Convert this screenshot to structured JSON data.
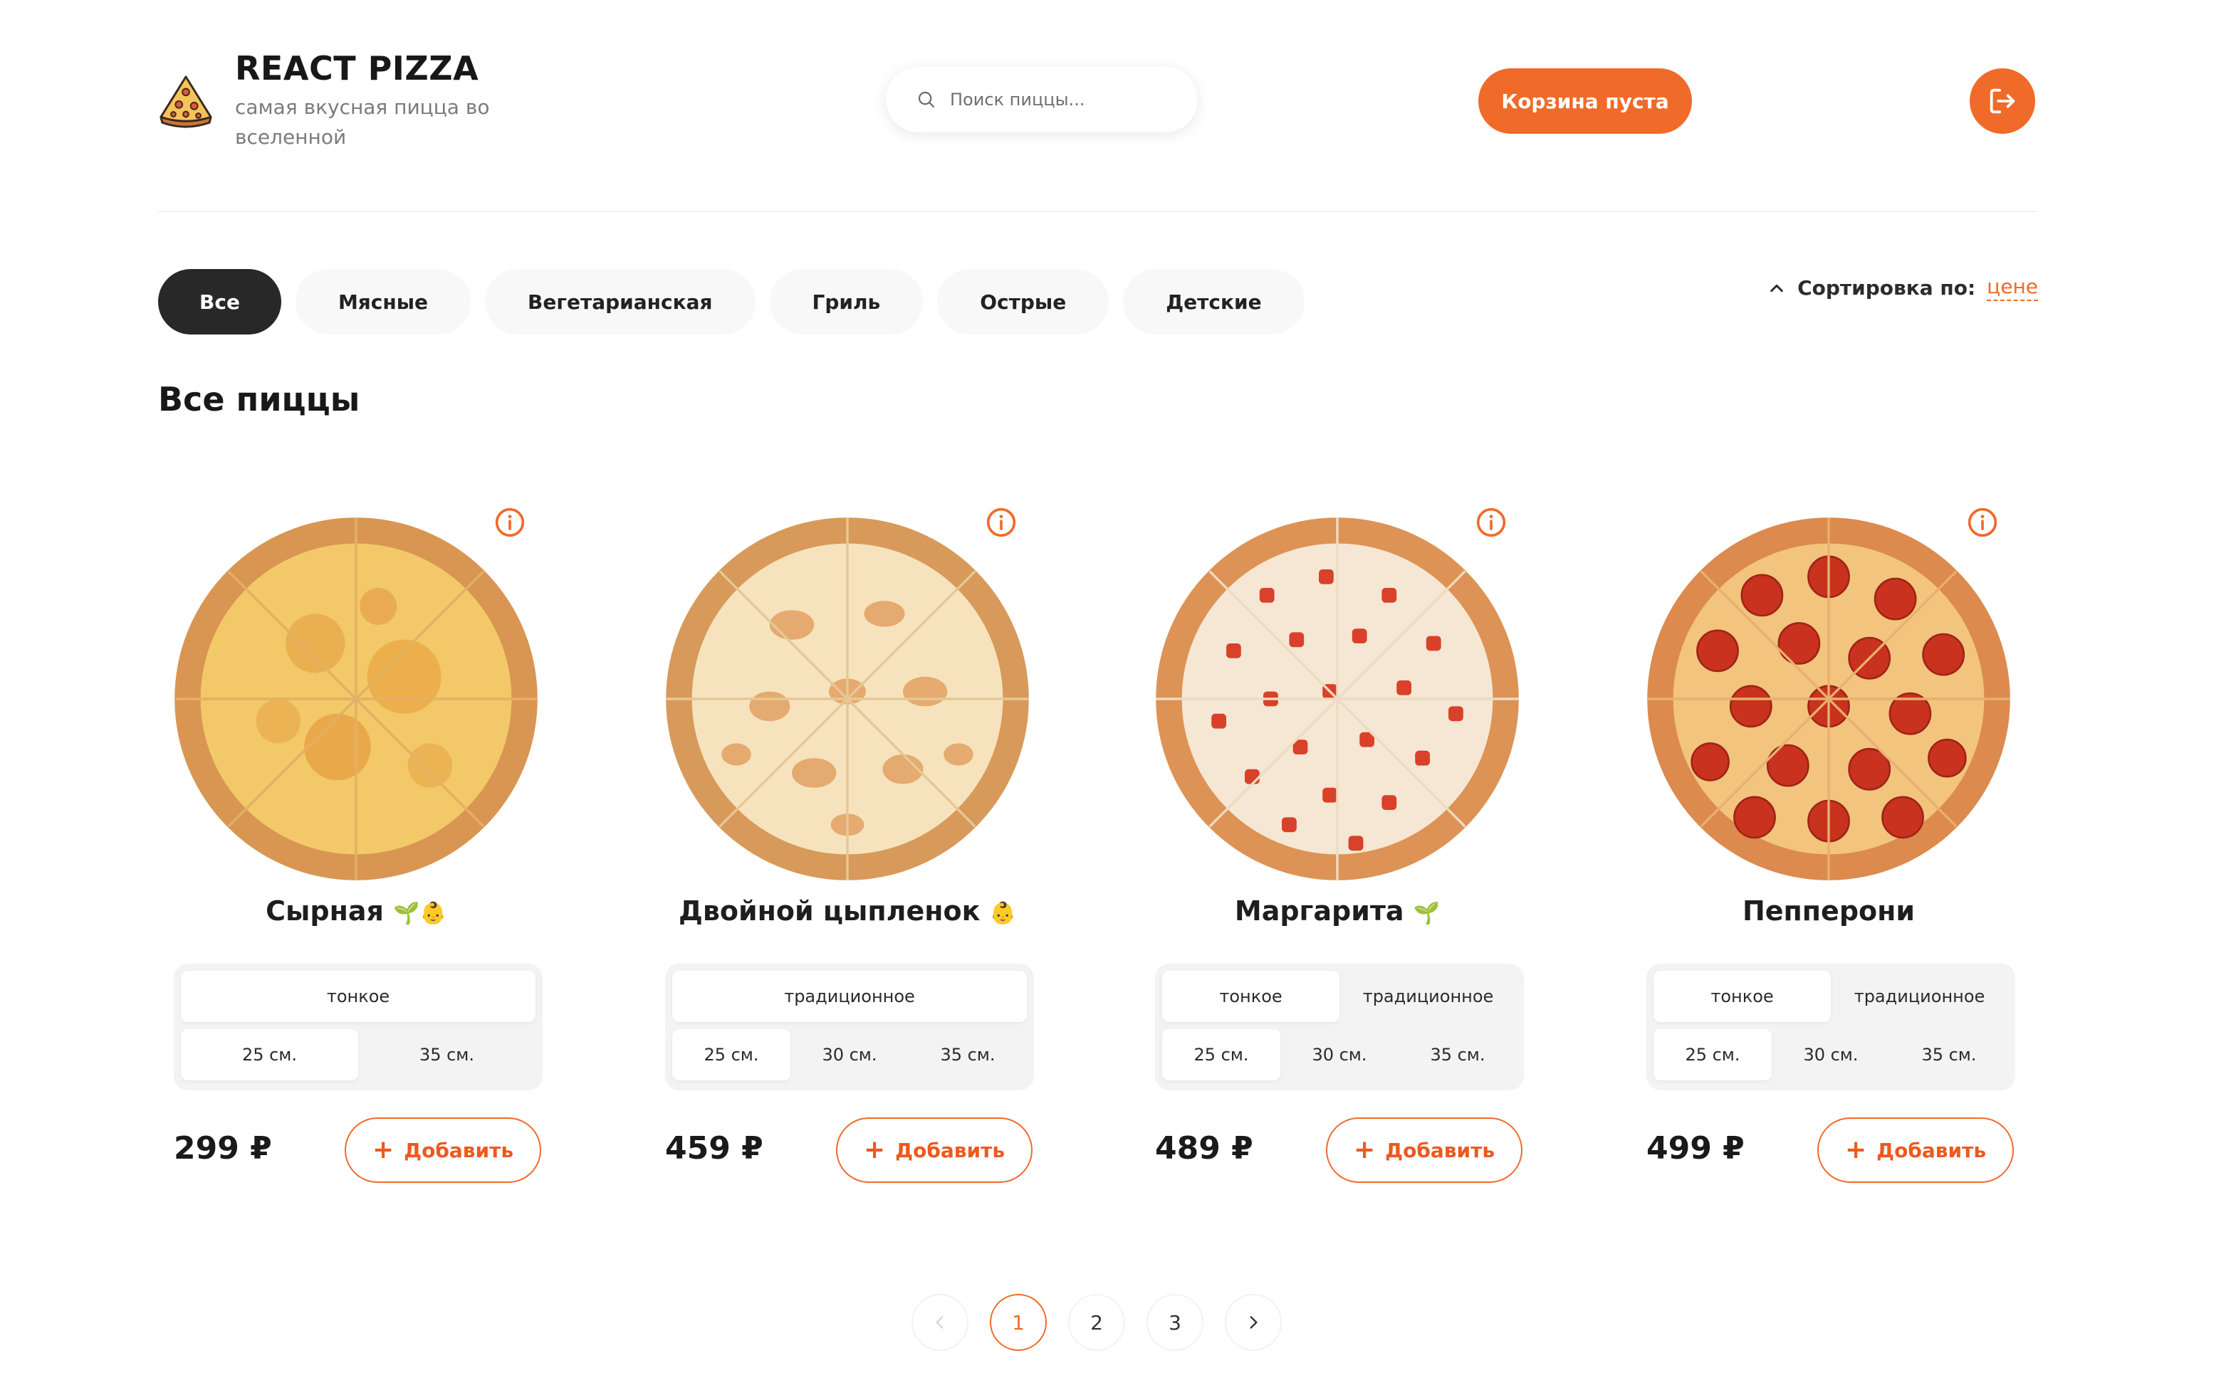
{
  "header": {
    "brand_title": "REACT PIZZA",
    "brand_subtitle": "самая вкусная пицца во вселенной",
    "search_placeholder": "Поиск пиццы...",
    "cart_label": "Корзина пуста",
    "logout_icon": "logout-icon",
    "logo_icon": "pizza-slice-icon"
  },
  "categories": [
    {
      "label": "Все",
      "active": true
    },
    {
      "label": "Мясные",
      "active": false
    },
    {
      "label": "Вегетарианская",
      "active": false
    },
    {
      "label": "Гриль",
      "active": false
    },
    {
      "label": "Острые",
      "active": false
    },
    {
      "label": "Детские",
      "active": false
    }
  ],
  "sort": {
    "label": "Сортировка по:",
    "value": "цене"
  },
  "section_title": "Все пиццы",
  "pizzas": [
    {
      "title": "Сырная",
      "badges": "🌱👶",
      "dough": [
        {
          "label": "тонкое",
          "selected": true
        }
      ],
      "sizes": [
        {
          "label": "25 см.",
          "selected": true
        },
        {
          "label": "35 см.",
          "selected": false
        }
      ],
      "price": "299 ₽",
      "add_label": "Добавить",
      "topping": "cheese"
    },
    {
      "title": "Двойной цыпленок",
      "badges": "👶",
      "dough": [
        {
          "label": "традиционное",
          "selected": true
        }
      ],
      "sizes": [
        {
          "label": "25 см.",
          "selected": true
        },
        {
          "label": "30 см.",
          "selected": false
        },
        {
          "label": "35 см.",
          "selected": false
        }
      ],
      "price": "459 ₽",
      "add_label": "Добавить",
      "topping": "chicken"
    },
    {
      "title": "Маргарита",
      "badges": "🌱",
      "dough": [
        {
          "label": "тонкое",
          "selected": true
        },
        {
          "label": "традиционное",
          "selected": false
        }
      ],
      "sizes": [
        {
          "label": "25 см.",
          "selected": true
        },
        {
          "label": "30 см.",
          "selected": false
        },
        {
          "label": "35 см.",
          "selected": false
        }
      ],
      "price": "489 ₽",
      "add_label": "Добавить",
      "topping": "tomato"
    },
    {
      "title": "Пепперони",
      "badges": "",
      "dough": [
        {
          "label": "тонкое",
          "selected": true
        },
        {
          "label": "традиционное",
          "selected": false
        }
      ],
      "sizes": [
        {
          "label": "25 см.",
          "selected": true
        },
        {
          "label": "30 см.",
          "selected": false
        },
        {
          "label": "35 см.",
          "selected": false
        }
      ],
      "price": "499 ₽",
      "add_label": "Добавить",
      "topping": "pepperoni"
    }
  ],
  "pagination": {
    "pages": [
      "1",
      "2",
      "3"
    ],
    "current": "1"
  },
  "colors": {
    "accent": "#f06a2a",
    "dark": "#282828",
    "chip_bg": "#f8f8f8"
  }
}
